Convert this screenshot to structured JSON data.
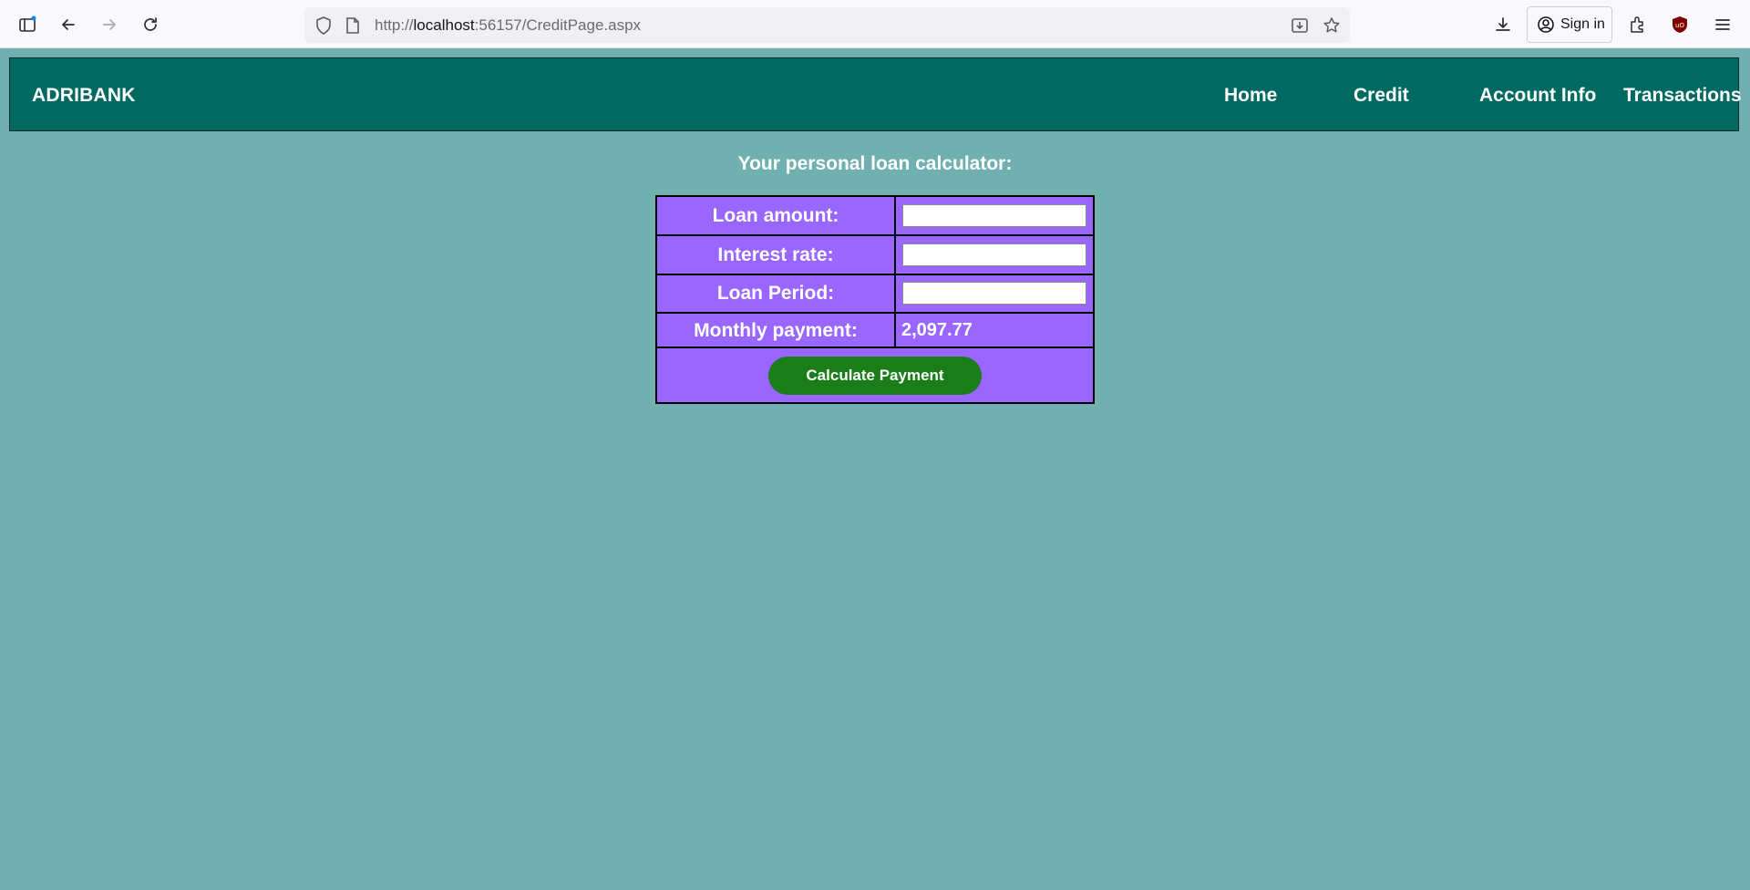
{
  "browser": {
    "url_prefix": "http://",
    "url_host": "localhost",
    "url_rest": ":56157/CreditPage.aspx",
    "sign_in_label": "Sign in"
  },
  "header": {
    "logo": "ADRIBANK",
    "nav": [
      {
        "label": "Home"
      },
      {
        "label": "Credit"
      },
      {
        "label": "Account Info"
      },
      {
        "label": "Transactions"
      }
    ]
  },
  "calculator": {
    "title": "Your personal loan calculator:",
    "rows": [
      {
        "label": "Loan amount:",
        "value": ""
      },
      {
        "label": "Interest rate:",
        "value": ""
      },
      {
        "label": "Loan Period:",
        "value": ""
      }
    ],
    "monthly_label": "Monthly payment:",
    "monthly_value": "2,097.77",
    "button_label": "Calculate Payment"
  },
  "colors": {
    "page_bg": "#70b0b0",
    "header_bg": "#006a62",
    "table_bg": "#9966ff",
    "button_bg": "#1a7d1a"
  }
}
